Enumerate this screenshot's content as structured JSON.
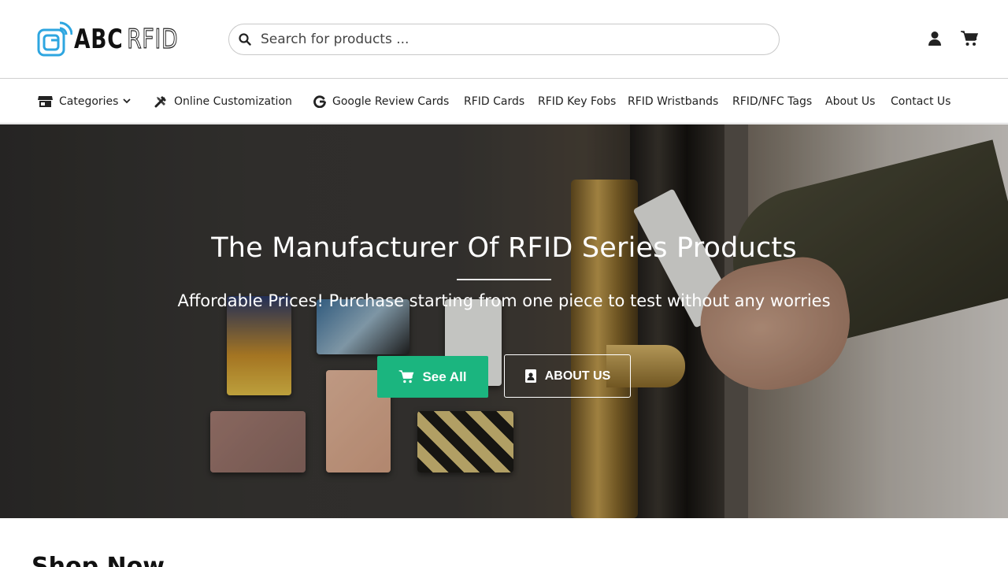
{
  "header": {
    "logo": {
      "brand_primary": "ABC",
      "brand_secondary": "RFID",
      "accent": "#2ea6e0"
    },
    "search": {
      "placeholder": "Search for products ...",
      "value": ""
    },
    "icons": {
      "account": "user-icon",
      "cart": "cart-icon"
    }
  },
  "nav": {
    "items": [
      {
        "label": "Categories",
        "icon": "store-icon",
        "has_dropdown": true
      },
      {
        "label": "Online Customization",
        "icon": "tools-icon"
      },
      {
        "label": "Google Review Cards",
        "icon": "google-icon"
      },
      {
        "label": "RFID Cards"
      },
      {
        "label": "RFID Key Fobs"
      },
      {
        "label": "RFID Wristbands"
      },
      {
        "label": "RFID/NFC Tags"
      },
      {
        "label": "About Us"
      },
      {
        "label": "Contact Us"
      }
    ]
  },
  "hero": {
    "title": "The Manufacturer Of RFID Series Products",
    "subtitle": "Affordable Prices! Purchase starting from one piece to test without any worries",
    "primary_button": {
      "label": "See All",
      "icon": "cart-icon",
      "color": "#1bb57f"
    },
    "secondary_button": {
      "label": "ABOUT US",
      "icon": "contact-book-icon"
    }
  },
  "section": {
    "shop_title": "Shop Now"
  }
}
